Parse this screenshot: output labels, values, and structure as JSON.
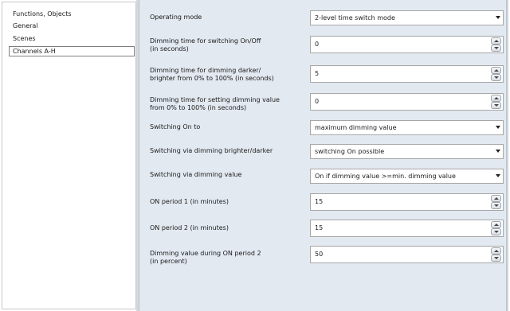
{
  "tree": {
    "items": [
      {
        "label": "Functions, Objects",
        "selected": false
      },
      {
        "label": "General",
        "selected": false
      },
      {
        "label": "Scenes",
        "selected": false
      },
      {
        "label": "Channels A-H",
        "selected": true
      }
    ]
  },
  "params": {
    "operating_mode": {
      "label": "Operating mode",
      "value": "2-level time switch mode"
    },
    "dimming_time_switching": {
      "label": "Dimming time for switching On/Off\n (in seconds)",
      "value": "0"
    },
    "dimming_time_darker_brighter": {
      "label": "Dimming time for dimming darker/\nbrighter from 0% to 100% (in seconds)",
      "value": "5"
    },
    "dimming_time_setting_value": {
      "label": "Dimming time for setting dimming value\nfrom 0% to 100% (in seconds)",
      "value": "0"
    },
    "switching_on_to": {
      "label": "Switching On to",
      "value": "maximum dimming value"
    },
    "switching_via_brighter_darker": {
      "label": "Switching via dimming brighter/darker",
      "value": "switching On possible"
    },
    "switching_via_dimming_value": {
      "label": "Switching via dimming value",
      "value": "On if dimming value >=min. dimming value"
    },
    "on_period_1": {
      "label": "ON period 1 (in minutes)",
      "value": "15"
    },
    "on_period_2": {
      "label": "ON period 2 (in minutes)",
      "value": "15"
    },
    "dimming_value_on_period_2": {
      "label": "Dimming value during ON period 2\n (in percent)",
      "value": "50"
    }
  }
}
